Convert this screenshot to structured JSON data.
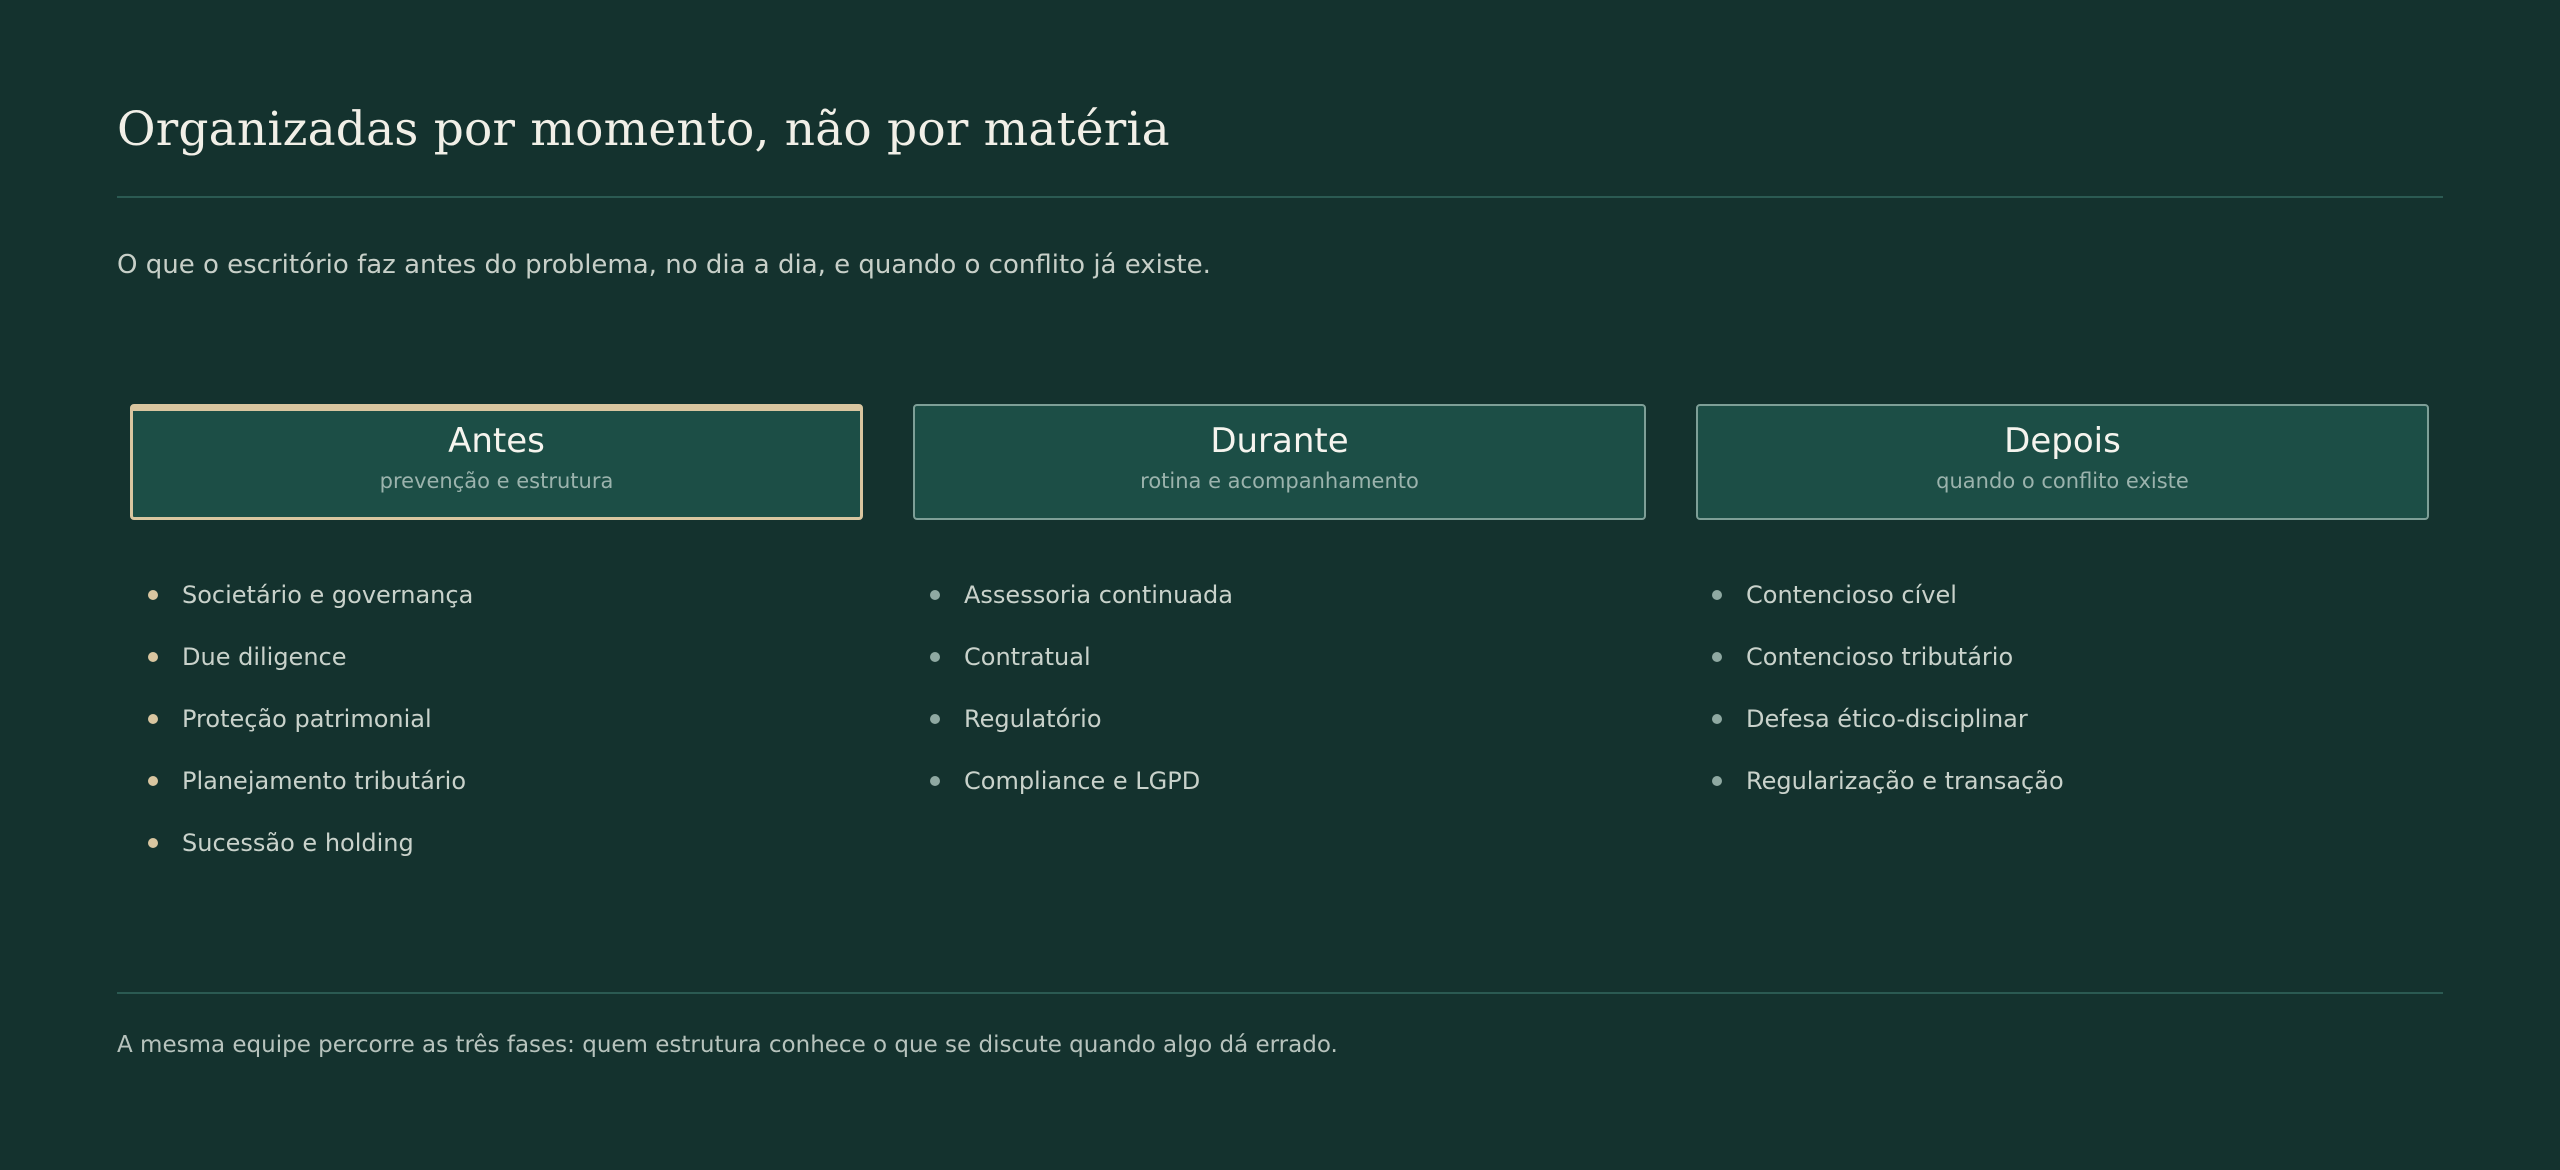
{
  "header": {
    "title": "Organizadas por momento, não por matéria",
    "lead": "O que o escritório faz antes do problema, no dia a dia, e quando o conflito já existe."
  },
  "tabs": [
    {
      "title": "Antes",
      "subtitle": "prevenção e estrutura",
      "active": true,
      "items": [
        "Societário e governança",
        "Due diligence",
        "Proteção patrimonial",
        "Planejamento tributário",
        "Sucessão e holding"
      ]
    },
    {
      "title": "Durante",
      "subtitle": "rotina e acompanhamento",
      "active": false,
      "items": [
        "Assessoria continuada",
        "Contratual",
        "Regulatório",
        "Compliance e LGPD"
      ]
    },
    {
      "title": "Depois",
      "subtitle": "quando o conflito existe",
      "active": false,
      "items": [
        "Contencioso cível",
        "Contencioso tributário",
        "Defesa ético-disciplinar",
        "Regularização e transação"
      ]
    }
  ],
  "footer": {
    "note": "A mesma equipe percorre as três fases: quem estrutura conhece o que se discute quando algo dá errado."
  },
  "colors": {
    "background": "#14322e",
    "tab_background": "#1c4e46",
    "accent_gold": "#d9c6a0",
    "tab_border": "#7e9f97",
    "divider": "#2b5a52"
  }
}
